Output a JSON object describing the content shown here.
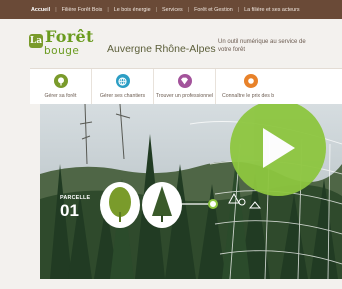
{
  "topnav": {
    "items": [
      {
        "label": "Accueil",
        "active": true
      },
      {
        "label": "Filière Forêt Bois",
        "active": false
      },
      {
        "label": "Le bois énergie",
        "active": false
      },
      {
        "label": "Services",
        "active": false
      },
      {
        "label": "Forêt et Gestion",
        "active": false
      },
      {
        "label": "La filière et ses acteurs",
        "active": false
      }
    ]
  },
  "header": {
    "logo": {
      "badge": "La",
      "line1": "Forêt",
      "line2": "bouge"
    },
    "region": "Auvergne Rhône-Alpes",
    "tagline": "Un outil numérique au service de votre forêt"
  },
  "tabs": [
    {
      "label": "Gérer sa forêt",
      "color": "#7a9b2b",
      "icon": "tree-icon"
    },
    {
      "label": "Gérer ses chantiers",
      "color": "#2c9ec4",
      "icon": "globe-icon"
    },
    {
      "label": "Trouver un professionnel",
      "color": "#a3539b",
      "icon": "diamond-icon"
    },
    {
      "label": "Connaître le prix des b",
      "color": "#e8822a",
      "icon": "price-icon"
    }
  ],
  "hero": {
    "parcel_label": "PARCELLE",
    "parcel_number": "01",
    "play_color": "#8dc63f"
  },
  "colors": {
    "nav_bg": "#6a4a37",
    "brand_green": "#6a9b1f"
  }
}
